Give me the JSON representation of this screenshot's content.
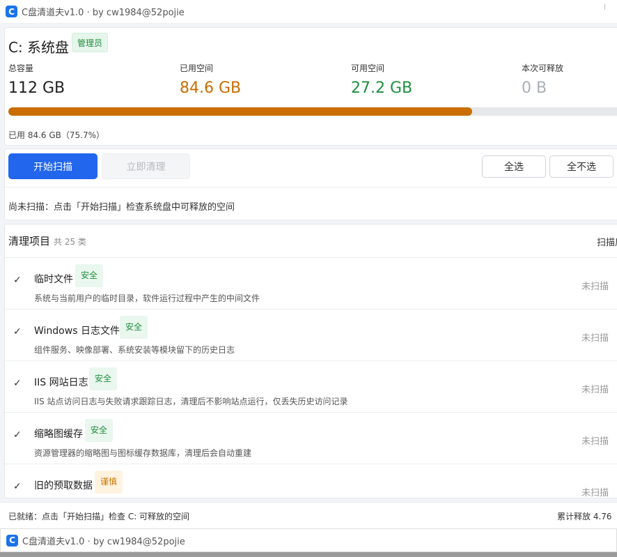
{
  "window": {
    "icon_letter": "C",
    "title": "C盘清道夫v1.0 · by cw1984@52pojie"
  },
  "disk": {
    "title": "C: 系统盘",
    "role_badge": "管理员",
    "stats": [
      {
        "label": "总容量",
        "value": "112 GB",
        "color": "#1f1f1f"
      },
      {
        "label": "已用空间",
        "value": "84.6 GB",
        "color": "#c96d00"
      },
      {
        "label": "可用空间",
        "value": "27.2 GB",
        "color": "#1e8e3e"
      },
      {
        "label": "本次可释放",
        "value": "0 B",
        "color": "#a9afb8"
      }
    ],
    "used_percent": 75.7,
    "used_text": "已用 84.6 GB（75.7%）"
  },
  "actions": {
    "scan_label": "开始扫描",
    "clean_label": "立即清理",
    "select_all_label": "全选",
    "select_none_label": "全不选",
    "scan_hint": "尚未扫描：点击「开始扫描」检查系统盘中可释放的空间"
  },
  "list": {
    "title": "清理项目",
    "count_text": "共 25 类",
    "right_label": "扫描后",
    "items": [
      {
        "name": "临时文件",
        "badge": "安全",
        "level": "safe",
        "desc": "系统与当前用户的临时目录，软件运行过程中产生的中间文件",
        "status": "未扫描"
      },
      {
        "name": "Windows 日志文件",
        "badge": "安全",
        "level": "safe",
        "desc": "组件服务、映像部署、系统安装等模块留下的历史日志",
        "status": "未扫描"
      },
      {
        "name": "IIS 网站日志",
        "badge": "安全",
        "level": "safe",
        "desc": "IIS 站点访问日志与失败请求跟踪日志，清理后不影响站点运行，仅丢失历史访问记录",
        "status": "未扫描"
      },
      {
        "name": "缩略图缓存",
        "badge": "安全",
        "level": "safe",
        "desc": "资源管理器的缩略图与图标缓存数据库，清理后会自动重建",
        "status": "未扫描"
      },
      {
        "name": "旧的预取数据",
        "badge": "谨慎",
        "level": "caution",
        "desc": "",
        "status": "未扫描"
      }
    ]
  },
  "status_bar": {
    "left": "已就绪：点击「开始扫描」检查 C: 可释放的空间",
    "right": "累计释放 4.76"
  }
}
